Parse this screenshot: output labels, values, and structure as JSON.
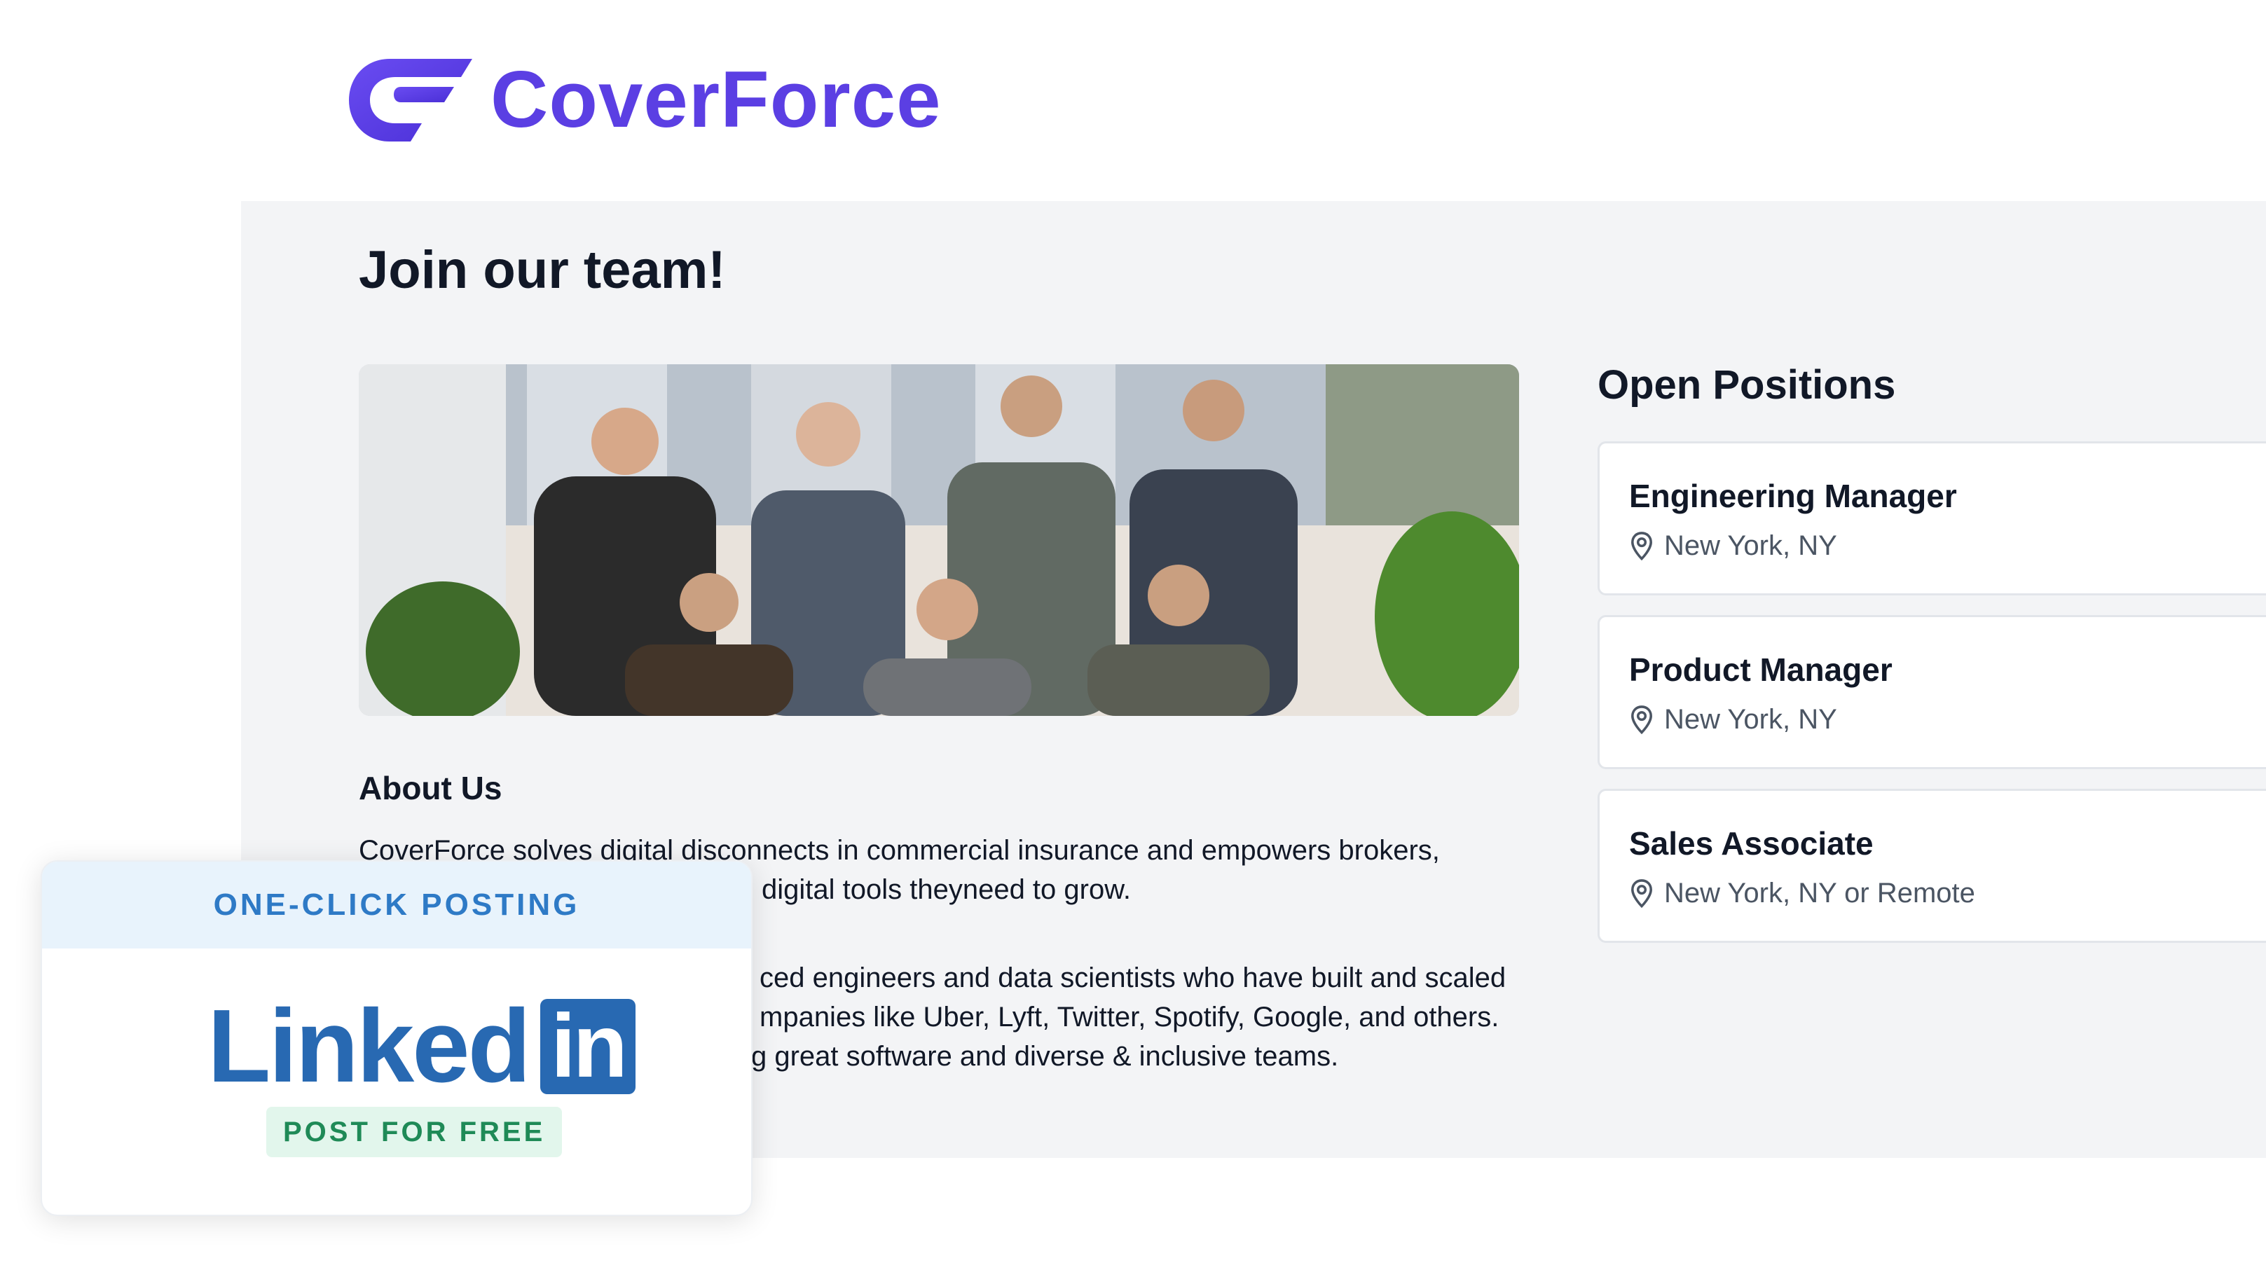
{
  "brand": {
    "name": "CoverForce",
    "color": "#5b3fe3"
  },
  "page": {
    "title": "Join our team!"
  },
  "about": {
    "title": "About Us",
    "paragraph1_lines": [
      "CoverForce solves digital disconnects in commercial insurance and empowers brokers,",
      "digital tools theyneed to grow."
    ],
    "paragraph2_lines": [
      "ced engineers and data scientists who have built and scaled",
      "mpanies like Uber, Lyft, Twitter, Spotify, Google, and others.",
      "g great software and diverse & inclusive teams."
    ]
  },
  "positions": {
    "title": "Open Positions",
    "items": [
      {
        "title": "Engineering Manager",
        "location": "New York, NY"
      },
      {
        "title": "Product Manager",
        "location": "New York, NY"
      },
      {
        "title": "Sales Associate",
        "location": "New York, NY or Remote"
      }
    ],
    "location_icon": "map-pin-icon"
  },
  "overlay": {
    "banner": "ONE-CLICK POSTING",
    "linkedin_word": "Linked",
    "linkedin_box": "in",
    "badge": "POST FOR FREE",
    "colors": {
      "banner_bg": "#e8f3fc",
      "banner_text": "#2e7ac6",
      "linkedin": "#2869b2",
      "badge_bg": "#e2f6ec",
      "badge_text": "#1f8a57"
    }
  }
}
